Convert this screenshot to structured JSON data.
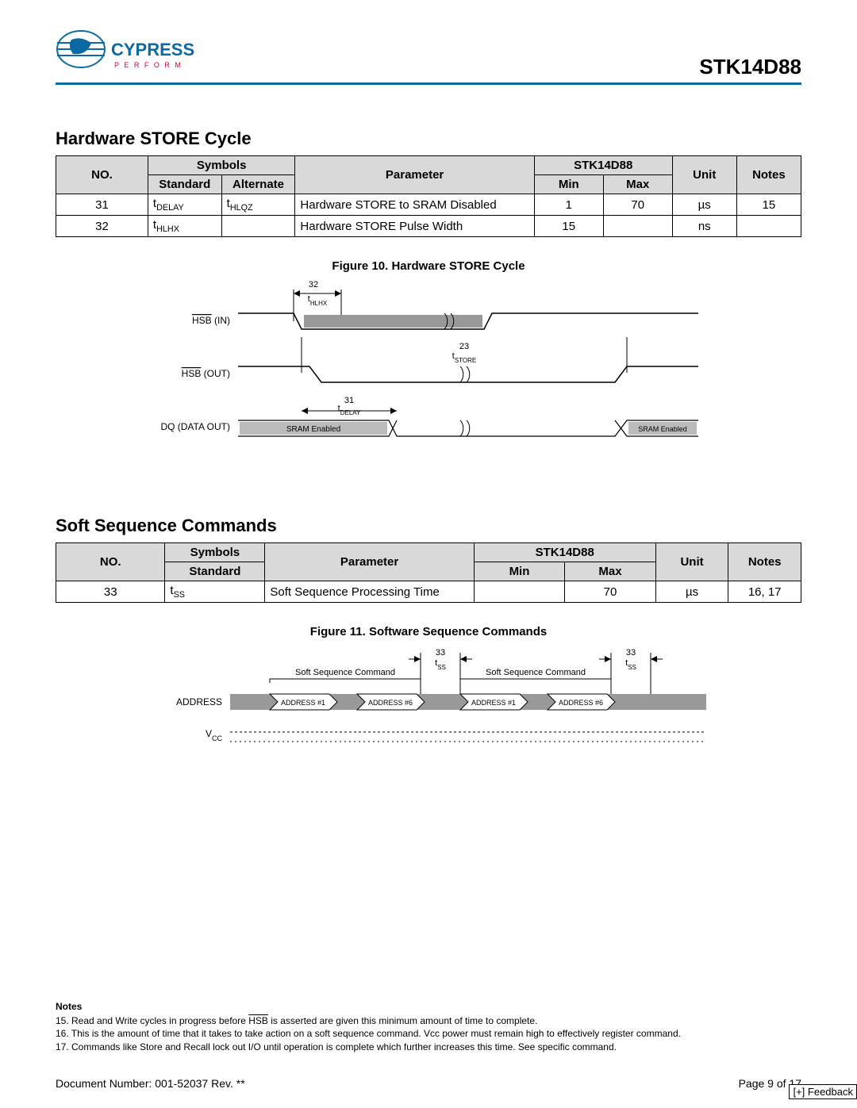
{
  "header": {
    "part_number": "STK14D88",
    "logo_brand": "CYPRESS",
    "logo_sub": "P E R F O R M"
  },
  "section1": {
    "title": "Hardware STORE Cycle",
    "columns": {
      "no": "NO.",
      "symbols": "Symbols",
      "standard": "Standard",
      "alternate": "Alternate",
      "parameter": "Parameter",
      "device": "STK14D88",
      "min": "Min",
      "max": "Max",
      "unit": "Unit",
      "notes": "Notes"
    },
    "rows": [
      {
        "no": "31",
        "standard_pre": "t",
        "standard_sub": "DELAY",
        "alternate_pre": "t",
        "alternate_sub": "HLQZ",
        "parameter": "Hardware STORE to SRAM Disabled",
        "min": "1",
        "max": "70",
        "unit": "µs",
        "notes": "15"
      },
      {
        "no": "32",
        "standard_pre": "t",
        "standard_sub": "HLHX",
        "alternate_pre": "",
        "alternate_sub": "",
        "parameter": "Hardware STORE Pulse Width",
        "min": "15",
        "max": "",
        "unit": "ns",
        "notes": ""
      }
    ],
    "figure_caption": "Figure 10.  Hardware STORE Cycle",
    "diagram": {
      "sig1": "HSB",
      "sig1_suffix": "  (IN)",
      "sig2": "HSB",
      "sig2_suffix": " (OUT)",
      "sig3": "DQ (DATA OUT)",
      "sram_enabled": "SRAM Enabled",
      "t32": "32",
      "t32l": "t",
      "t32s": "HLHX",
      "t23": "23",
      "t23l": "t",
      "t23s": "STORE",
      "t31": "31",
      "t31l": "t",
      "t31s": "DELAY"
    }
  },
  "section2": {
    "title": "Soft Sequence Commands",
    "columns": {
      "no": "NO.",
      "symbols": "Symbols",
      "standard": "Standard",
      "parameter": "Parameter",
      "device": "STK14D88",
      "min": "Min",
      "max": "Max",
      "unit": "Unit",
      "notes": "Notes"
    },
    "rows": [
      {
        "no": "33",
        "standard_pre": "t",
        "standard_sub": "SS",
        "parameter": "Soft Sequence Processing Time",
        "min": "",
        "max": "70",
        "unit": "µs",
        "notes": "16, 17"
      }
    ],
    "figure_caption": "Figure 11.  Software Sequence Commands",
    "diagram": {
      "sig1": "ADDRESS",
      "sig2": "V",
      "sig2_sub": "CC",
      "ssc": "Soft Sequence Command",
      "a1": "ADDRESS #1",
      "a6": "ADDRESS #6",
      "t33": "33",
      "t33l": "t",
      "t33s": "SS"
    }
  },
  "notes": {
    "heading": "Notes",
    "n15a": "15. Read and Write cycles in progress before ",
    "n15b": " is asserted are given this minimum amount of time to complete.",
    "n15_over": "HSB",
    "n16": "16. This is the amount of time that it takes to take action on a soft sequence command. Vcc power must remain high to effectively register command.",
    "n17": "17. Commands like Store and Recall lock out I/O until operation is complete which further increases this time. See specific command."
  },
  "footer": {
    "doc": "Document Number: 001-52037 Rev. **",
    "page": "Page 9 of 17",
    "feedback": "[+] Feedback"
  }
}
